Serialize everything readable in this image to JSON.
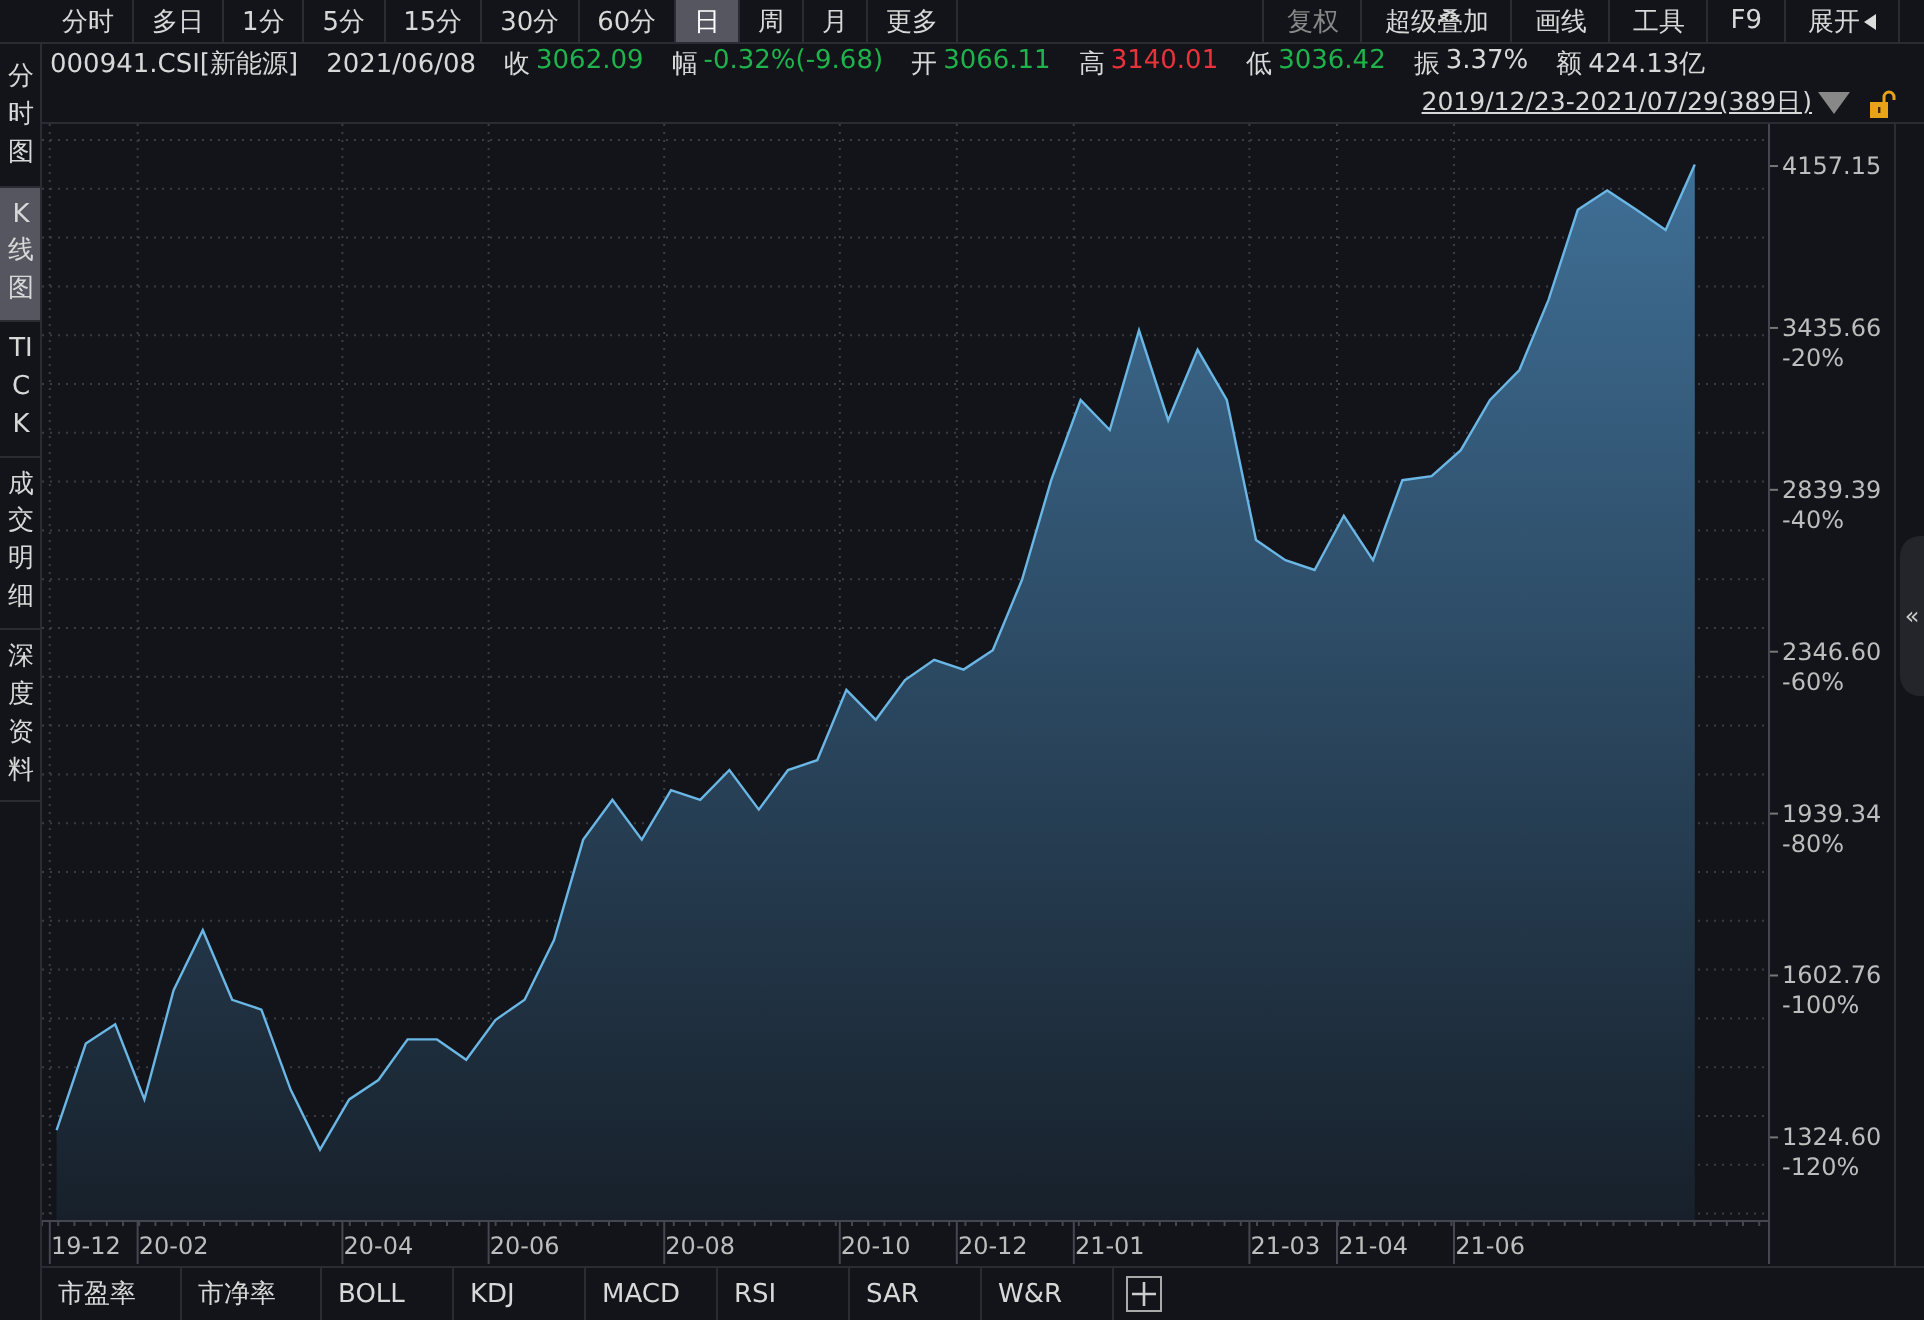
{
  "period_tabs": [
    {
      "label": "分时",
      "selected": false
    },
    {
      "label": "多日",
      "selected": false
    },
    {
      "label": "1分",
      "selected": false
    },
    {
      "label": "5分",
      "selected": false
    },
    {
      "label": "15分",
      "selected": false
    },
    {
      "label": "30分",
      "selected": false
    },
    {
      "label": "60分",
      "selected": false
    },
    {
      "label": "日",
      "selected": true
    },
    {
      "label": "周",
      "selected": false
    },
    {
      "label": "月",
      "selected": false
    },
    {
      "label": "更多",
      "selected": false
    }
  ],
  "tool_buttons": [
    {
      "label": "复权",
      "disabled": true
    },
    {
      "label": "超级叠加",
      "disabled": false
    },
    {
      "label": "画线",
      "disabled": false
    },
    {
      "label": "工具",
      "disabled": false
    },
    {
      "label": "F9",
      "disabled": false
    },
    {
      "label": "展开",
      "disabled": false
    }
  ],
  "side_tabs": [
    {
      "label": "分时图",
      "selected": false
    },
    {
      "label": "K线图",
      "selected": true
    },
    {
      "label": "TICK",
      "selected": false
    },
    {
      "label": "成交明细",
      "selected": false
    },
    {
      "label": "深度资料",
      "selected": false
    }
  ],
  "quote": {
    "code": "000941.CSI[新能源]",
    "date": "2021/06/08",
    "fields": [
      {
        "label": "收",
        "value": "3062.09",
        "color": "#1fb34b"
      },
      {
        "label": "幅",
        "value": "-0.32%(-9.68)",
        "color": "#1fb34b"
      },
      {
        "label": "开",
        "value": "3066.11",
        "color": "#1fb34b"
      },
      {
        "label": "高",
        "value": "3140.01",
        "color": "#e8333c"
      },
      {
        "label": "低",
        "value": "3036.42",
        "color": "#1fb34b"
      },
      {
        "label": "振",
        "value": "3.37%",
        "color": "#d8d8d8"
      },
      {
        "label": "额",
        "value": "424.13亿",
        "color": "#d8d8d8"
      }
    ]
  },
  "range": {
    "text": "2019/12/23-2021/07/29(389日)",
    "locked": false
  },
  "price_labels": [
    "4157.15",
    "3435.66",
    "2839.39",
    "2346.60",
    "1939.34",
    "1602.76",
    "1324.60"
  ],
  "chart_data": {
    "type": "area",
    "grid": true,
    "ylim": [
      -126.5,
      8.9
    ],
    "categories": [
      null,
      "19-12",
      null,
      null,
      "20-02",
      null,
      null,
      null,
      null,
      null,
      null,
      "20-04",
      null,
      null,
      null,
      null,
      "20-06",
      null,
      null,
      null,
      null,
      null,
      "20-08",
      null,
      null,
      null,
      null,
      null,
      "20-10",
      null,
      null,
      null,
      "20-12",
      null,
      null,
      null,
      "21-01",
      null,
      null,
      null,
      null,
      null,
      "21-03",
      null,
      null,
      "21-04",
      null,
      null,
      null,
      "21-06",
      null,
      null,
      null,
      null,
      null,
      null,
      null,
      null,
      null
    ],
    "yticks": [
      {
        "value": -20,
        "label": "-20%"
      },
      {
        "value": -40,
        "label": "-40%"
      },
      {
        "value": -60,
        "label": "-60%"
      },
      {
        "value": -80,
        "label": "-80%"
      },
      {
        "value": -100,
        "label": "-100%"
      },
      {
        "value": -120,
        "label": "-120%"
      }
    ],
    "series": [
      {
        "color": "#6ab7e6",
        "values": [
          -115.4,
          -104.7,
          -102.3,
          -111.6,
          -98.1,
          -90.7,
          -99.3,
          -100.5,
          -110.4,
          -117.8,
          -111.6,
          -109.2,
          -104.2,
          -104.2,
          -106.7,
          -101.8,
          -99.3,
          -91.9,
          -79.5,
          -74.6,
          -79.5,
          -73.4,
          -74.6,
          -70.9,
          -75.8,
          -70.9,
          -69.7,
          -61.0,
          -64.7,
          -59.8,
          -57.3,
          -58.5,
          -56.1,
          -47.4,
          -35.1,
          -25.2,
          -28.9,
          -16.6,
          -27.7,
          -19.0,
          -25.2,
          -42.5,
          -45.0,
          -46.2,
          -39.5,
          -45.0,
          -35.1,
          -34.6,
          -31.4,
          -25.2,
          -21.5,
          -12.8,
          -1.7,
          0.7,
          -1.7,
          -4.2,
          3.9,
          null,
          null
        ]
      }
    ]
  },
  "collapse_toggle": "«",
  "indicator_tabs": [
    "市盈率",
    "市净率",
    "BOLL",
    "KDJ",
    "MACD",
    "RSI",
    "SAR",
    "W&R"
  ]
}
